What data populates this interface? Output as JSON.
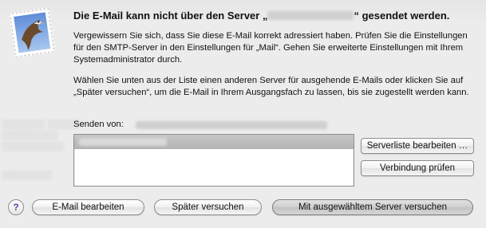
{
  "dialog": {
    "title_before": "Die E-Mail kann nicht über den Server „",
    "title_after": "“ gesendet werden.",
    "paragraph1": "Vergewissern Sie sich, dass Sie diese E-Mail korrekt adressiert haben. Prüfen Sie die Einstellungen für den SMTP-Server in den Einstellungen für „Mail“. Gehen Sie erweiterte Einstellungen mit Ihrem Systemadministrator durch.",
    "paragraph2": "Wählen Sie unten aus der Liste einen anderen Server für ausgehende E-Mails oder klicken Sie auf „Später versuchen“, um die E-Mail in Ihrem Ausgangsfach zu lassen, bis sie zugestellt werden kann.",
    "send_from_label": "Senden von:"
  },
  "buttons": {
    "edit_server_list": "Serverliste bearbeiten …",
    "check_connection": "Verbindung prüfen",
    "help": "?",
    "edit_email": "E-Mail bearbeiten",
    "try_later": "Später versuchen",
    "try_selected_server": "Mit ausgewähltem Server versuchen"
  },
  "icons": {
    "app_icon": "mail-stamp-eagle-icon",
    "help": "help-icon"
  }
}
